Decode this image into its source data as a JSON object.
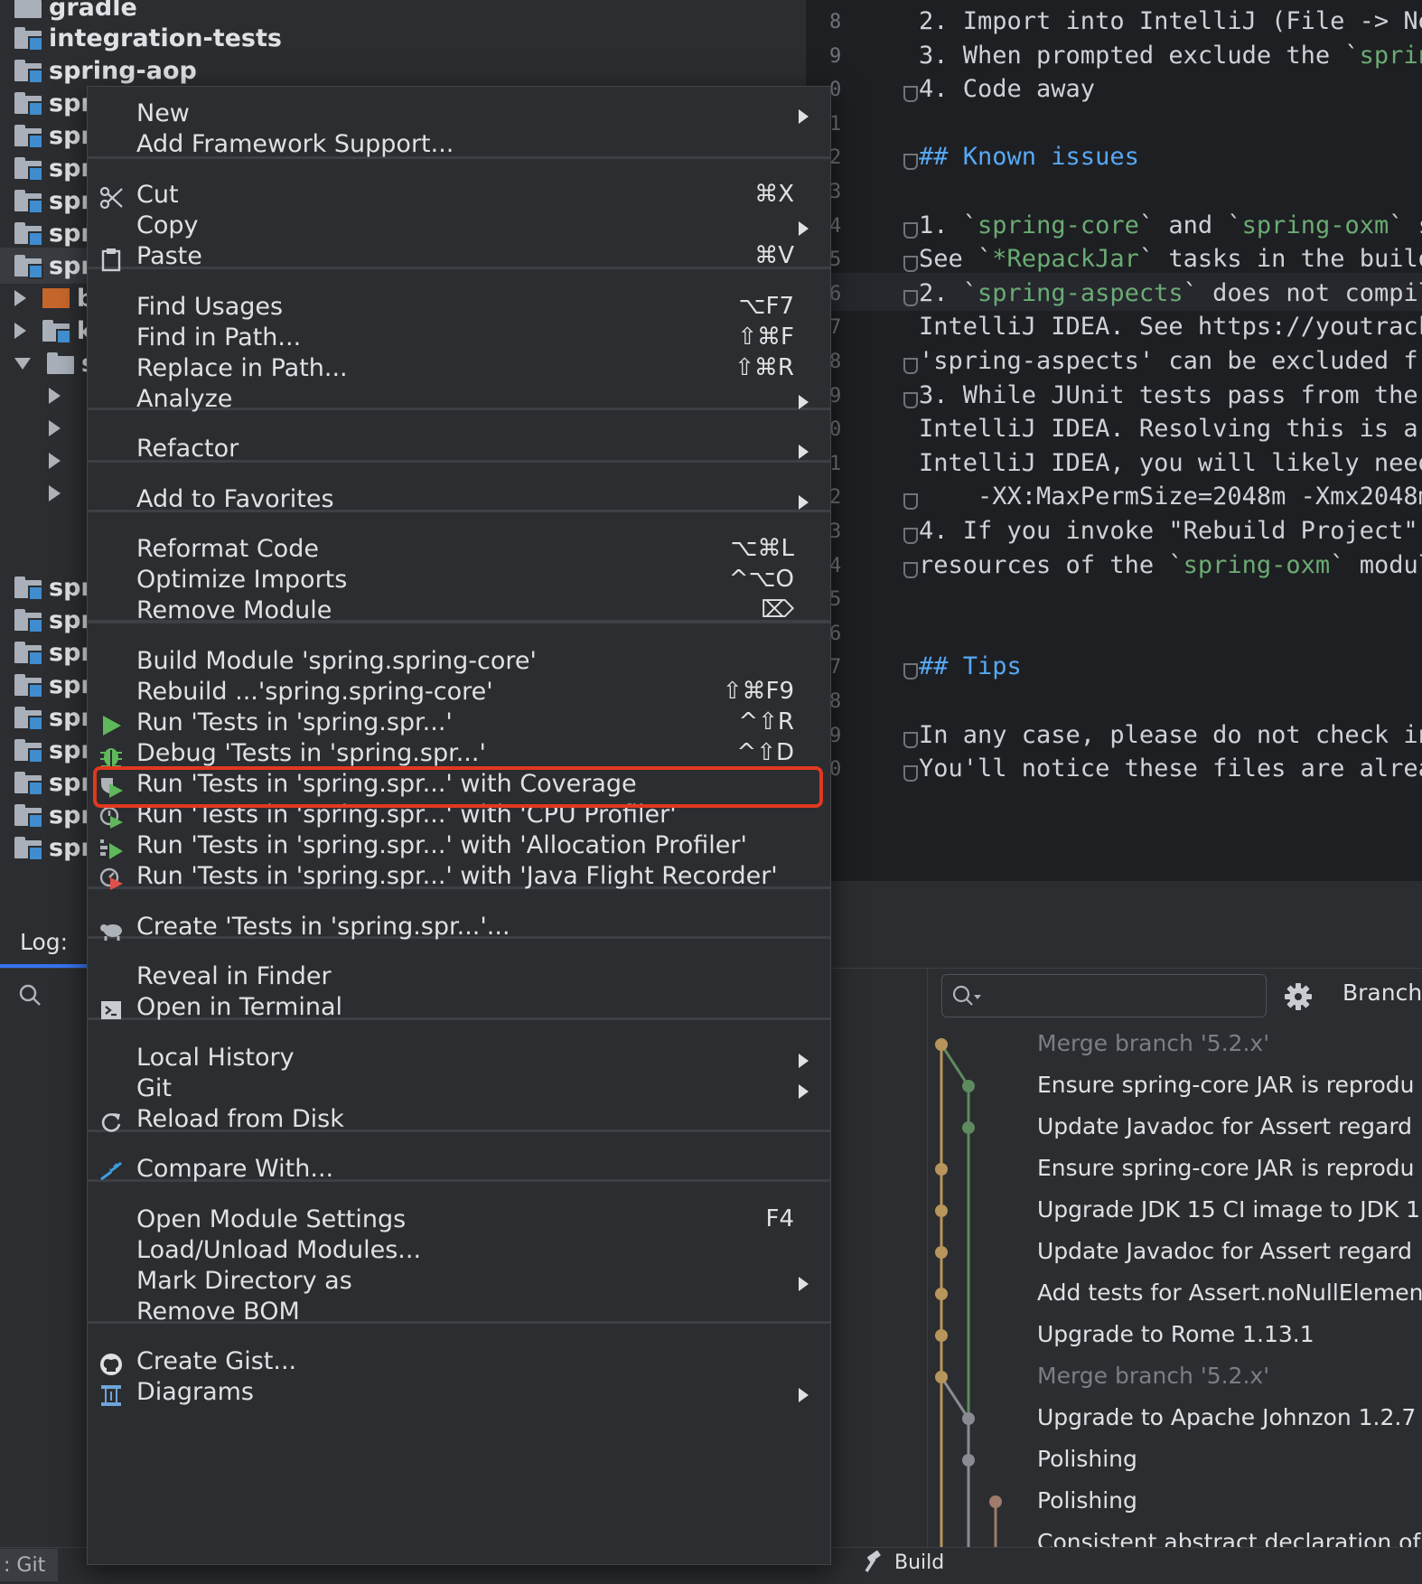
{
  "tree": {
    "rows": [
      {
        "label": "gradle",
        "arrow": ""
      },
      {
        "label": "integration-tests",
        "arrow": ""
      },
      {
        "label": "spring-aop",
        "arrow": ""
      },
      {
        "label": "spr",
        "arrow": ""
      },
      {
        "label": "spr",
        "arrow": ""
      },
      {
        "label": "spr",
        "arrow": ""
      },
      {
        "label": "spr",
        "arrow": ""
      },
      {
        "label": "spr",
        "arrow": ""
      },
      {
        "label": "spr",
        "arrow": ""
      },
      {
        "label": "b",
        "arrow": "right"
      },
      {
        "label": "k",
        "arrow": "right"
      },
      {
        "label": "s",
        "arrow": "down"
      }
    ],
    "lower_rows": [
      "spr",
      "spr",
      "spr",
      "spr",
      "spr",
      "spr",
      "spr",
      "spr",
      "spr"
    ]
  },
  "editor": {
    "gutter": [
      "8",
      "9",
      "0",
      "1",
      "2",
      "3",
      "4",
      "5",
      "6",
      "7",
      "8",
      "9",
      "0",
      "1",
      "2",
      "3",
      "4",
      "5",
      "6",
      "7",
      "8",
      "9",
      "0"
    ],
    "lines": [
      "2. Import into IntelliJ (File -> Ne",
      "3. When prompted exclude the `sprin",
      "4. Code away",
      "",
      "## Known issues",
      "",
      "1. `spring-core` and `spring-oxm` s",
      "See `*RepackJar` tasks in the build",
      "2. `spring-aspects` does not compil",
      "IntelliJ IDEA. See https://youtrack",
      "'spring-aspects' can be excluded fr",
      "3. While JUnit tests pass from the ",
      "IntelliJ IDEA. Resolving this is a ",
      "IntelliJ IDEA, you will likely need",
      "    -XX:MaxPermSize=2048m -Xmx2048m",
      "4. If you invoke \"Rebuild Project\" ",
      "resources of the `spring-oxm` modul",
      "",
      "",
      "## Tips",
      "",
      "In any case, please do not check in",
      "You'll notice these files are alrea"
    ]
  },
  "log": {
    "tab_label": "Log:",
    "search_placeholder": "",
    "branch_label": "Branch",
    "commits": [
      "Merge branch '5.2.x'",
      "Ensure spring-core JAR is reprodu",
      "Update Javadoc for Assert regard",
      "Ensure spring-core JAR is reprodu",
      "Upgrade JDK 15 CI image to JDK 1",
      "Update Javadoc for Assert regard",
      "Add tests for Assert.noNullElemen",
      "Upgrade to Rome 1.13.1",
      "Merge branch '5.2.x'",
      "Upgrade to Apache Johnzon 1.2.7",
      "Polishing",
      "Polishing",
      "Consistent abstract declaration of"
    ]
  },
  "status": {
    "git_label": ": Git",
    "build_label": "Build"
  },
  "menu": {
    "items": [
      {
        "label": "New",
        "shortcut": "",
        "submenu": true
      },
      {
        "label": "Add Framework Support...",
        "shortcut": "",
        "submenu": false
      },
      {
        "label": "Cut",
        "shortcut": "⌘X",
        "submenu": false,
        "icon": "scissors-icon"
      },
      {
        "label": "Copy",
        "shortcut": "",
        "submenu": true
      },
      {
        "label": "Paste",
        "shortcut": "⌘V",
        "submenu": false,
        "icon": "clipboard-icon"
      },
      {
        "label": "Find Usages",
        "shortcut": "⌥F7",
        "submenu": false
      },
      {
        "label": "Find in Path...",
        "shortcut": "⇧⌘F",
        "submenu": false
      },
      {
        "label": "Replace in Path...",
        "shortcut": "⇧⌘R",
        "submenu": false
      },
      {
        "label": "Analyze",
        "shortcut": "",
        "submenu": true
      },
      {
        "label": "Refactor",
        "shortcut": "",
        "submenu": true
      },
      {
        "label": "Add to Favorites",
        "shortcut": "",
        "submenu": true
      },
      {
        "label": "Reformat Code",
        "shortcut": "⌥⌘L",
        "submenu": false
      },
      {
        "label": "Optimize Imports",
        "shortcut": "^⌥O",
        "submenu": false
      },
      {
        "label": "Remove Module",
        "shortcut": "⌦",
        "submenu": false
      },
      {
        "label": "Build Module 'spring.spring-core'",
        "shortcut": "",
        "submenu": false
      },
      {
        "label": "Rebuild ...'spring.spring-core'",
        "shortcut": "⇧⌘F9",
        "submenu": false
      },
      {
        "label": "Run 'Tests in 'spring.spr...'",
        "shortcut": "^⇧R",
        "submenu": false,
        "icon": "run-icon"
      },
      {
        "label": "Debug 'Tests in 'spring.spr...'",
        "shortcut": "^⇧D",
        "submenu": false,
        "icon": "debug-icon"
      },
      {
        "label": "Run 'Tests in 'spring.spr...' with Coverage",
        "shortcut": "",
        "submenu": false,
        "icon": "coverage-icon"
      },
      {
        "label": "Run 'Tests in 'spring.spr...' with 'CPU Profiler'",
        "shortcut": "",
        "submenu": false,
        "icon": "cpu-profiler-icon"
      },
      {
        "label": "Run 'Tests in 'spring.spr...' with 'Allocation Profiler'",
        "shortcut": "",
        "submenu": false,
        "icon": "allocation-profiler-icon"
      },
      {
        "label": "Run 'Tests in 'spring.spr...' with 'Java Flight Recorder'",
        "shortcut": "",
        "submenu": false,
        "icon": "flight-recorder-icon"
      },
      {
        "label": "Create 'Tests in 'spring.spr...'...",
        "shortcut": "",
        "submenu": false,
        "icon": "create-config-icon"
      },
      {
        "label": "Reveal in Finder",
        "shortcut": "",
        "submenu": false
      },
      {
        "label": "Open in Terminal",
        "shortcut": "",
        "submenu": false,
        "icon": "terminal-icon"
      },
      {
        "label": "Local History",
        "shortcut": "",
        "submenu": true
      },
      {
        "label": "Git",
        "shortcut": "",
        "submenu": true
      },
      {
        "label": "Reload from Disk",
        "shortcut": "",
        "submenu": false,
        "icon": "reload-icon"
      },
      {
        "label": "Compare With...",
        "shortcut": "",
        "submenu": false,
        "icon": "compare-icon"
      },
      {
        "label": "Open Module Settings",
        "shortcut": "F4",
        "submenu": false
      },
      {
        "label": "Load/Unload Modules...",
        "shortcut": "",
        "submenu": false
      },
      {
        "label": "Mark Directory as",
        "shortcut": "",
        "submenu": true
      },
      {
        "label": "Remove BOM",
        "shortcut": "",
        "submenu": false
      },
      {
        "label": "Create Gist...",
        "shortcut": "",
        "submenu": false,
        "icon": "github-icon"
      },
      {
        "label": "Diagrams",
        "shortcut": "",
        "submenu": true,
        "icon": "diagram-icon"
      }
    ],
    "highlighted_item": "Run 'Tests in 'spring.spr...'",
    "highlight_color": "#e0391f"
  }
}
